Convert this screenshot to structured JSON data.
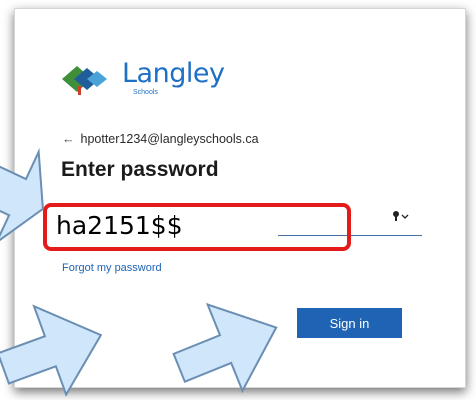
{
  "logo": {
    "word": "Langley",
    "sub": "Schools"
  },
  "account": {
    "email": "hpotter1234@langleyschools.ca",
    "back_icon": "back-arrow-icon"
  },
  "title": "Enter password",
  "password": {
    "value": "ha2151$$",
    "reveal_icon": "key-dropdown-icon"
  },
  "forgot_link": "Forgot my password",
  "signin_button": "Sign in",
  "colors": {
    "accent": "#1f63b5",
    "highlight": "#e31b1b",
    "arrow": "#cfe6fb",
    "logo_green": "#3f8f3a",
    "logo_red": "#d43b2b"
  }
}
